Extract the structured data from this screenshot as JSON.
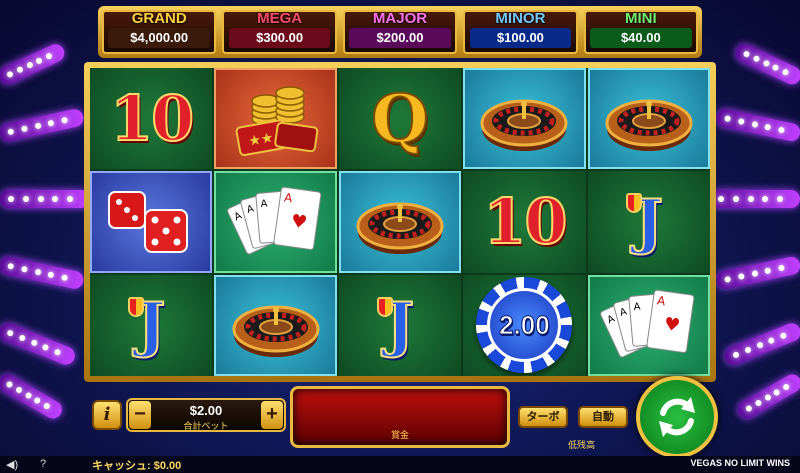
{
  "jackpots": [
    {
      "name": "GRAND",
      "value": "$4,000.00",
      "name_color": "#ffd040",
      "value_bg": "#3a1a0a"
    },
    {
      "name": "MEGA",
      "value": "$300.00",
      "name_color": "#ff4a6a",
      "value_bg": "#6a0a1a"
    },
    {
      "name": "MAJOR",
      "value": "$200.00",
      "name_color": "#ff70f0",
      "value_bg": "#5a0a5a"
    },
    {
      "name": "MINOR",
      "value": "$100.00",
      "name_color": "#70c8ff",
      "value_bg": "#0a2a8a"
    },
    {
      "name": "MINI",
      "value": "$40.00",
      "name_color": "#70f070",
      "value_bg": "#0a5a1a"
    }
  ],
  "reels": [
    [
      {
        "symbol": "10",
        "bg": "green"
      },
      {
        "symbol": "coins-tickets",
        "bg": "red"
      },
      {
        "symbol": "Q",
        "bg": "green"
      },
      {
        "symbol": "roulette",
        "bg": "teal"
      },
      {
        "symbol": "roulette",
        "bg": "teal"
      }
    ],
    [
      {
        "symbol": "dice",
        "bg": "blue"
      },
      {
        "symbol": "cards",
        "bg": "mint"
      },
      {
        "symbol": "roulette",
        "bg": "teal"
      },
      {
        "symbol": "10",
        "bg": "green"
      },
      {
        "symbol": "J",
        "bg": "green"
      }
    ],
    [
      {
        "symbol": "J",
        "bg": "green"
      },
      {
        "symbol": "roulette",
        "bg": "teal"
      },
      {
        "symbol": "J",
        "bg": "green"
      },
      {
        "symbol": "chip",
        "bg": "green",
        "value": "2.00"
      },
      {
        "symbol": "cards",
        "bg": "mint"
      }
    ]
  ],
  "controls": {
    "info": "i",
    "minus": "−",
    "plus": "+",
    "bet_value": "$2.00",
    "bet_label": "合計ベット",
    "win_label": "賞金",
    "turbo": "ターボ",
    "auto": "自動",
    "low_label": "低残高"
  },
  "status": {
    "cash": "キャッシュ: $0.00",
    "game_name": "VEGAS NO LIMIT WINS"
  }
}
